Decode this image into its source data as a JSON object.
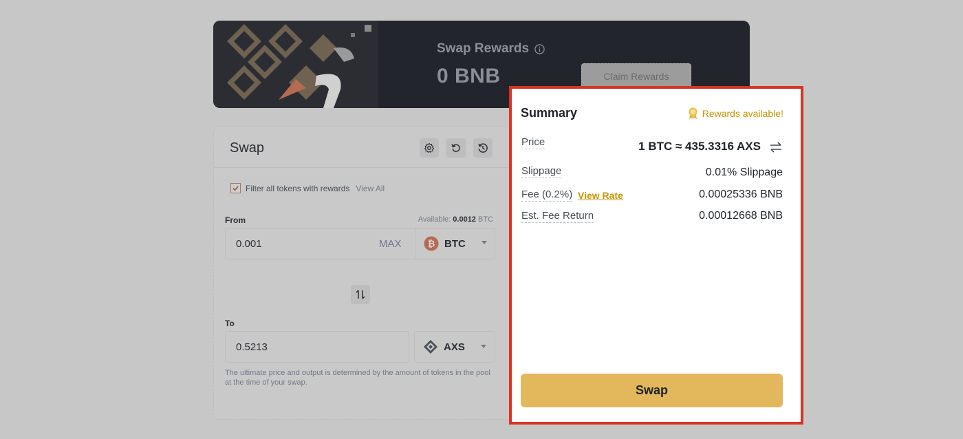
{
  "banner": {
    "title": "Swap Rewards",
    "amount": "0 BNB",
    "claim_label": "Claim Rewards"
  },
  "swap": {
    "title": "Swap",
    "filter_label": "Filter all tokens with rewards",
    "view_all": "View All",
    "from_label": "From",
    "available_label": "Available:",
    "available_amount": "0.0012",
    "available_unit": "BTC",
    "from_value": "0.001",
    "max_label": "MAX",
    "from_token": "BTC",
    "to_label": "To",
    "to_value": "0.5213",
    "to_token": "AXS",
    "disclaimer": "The ultimate price and output is determined by the amount of tokens in the pool at the time of your swap."
  },
  "summary": {
    "title": "Summary",
    "rewards_available": "Rewards available!",
    "price_label": "Price",
    "price_value": "1 BTC ≈ 435.3316 AXS",
    "slippage_label": "Slippage",
    "slippage_value": "0.01% Slippage",
    "fee_label": "Fee (0.2%)",
    "view_rate": "View Rate",
    "fee_value": "0.00025336 BNB",
    "fee_return_label": "Est. Fee Return",
    "fee_return_value": "0.00012668 BNB",
    "swap_button": "Swap"
  },
  "colors": {
    "accent": "#e3b85c",
    "highlight_border": "#d93325",
    "reward_text": "#c99400",
    "banner_bg": "#22252b"
  }
}
